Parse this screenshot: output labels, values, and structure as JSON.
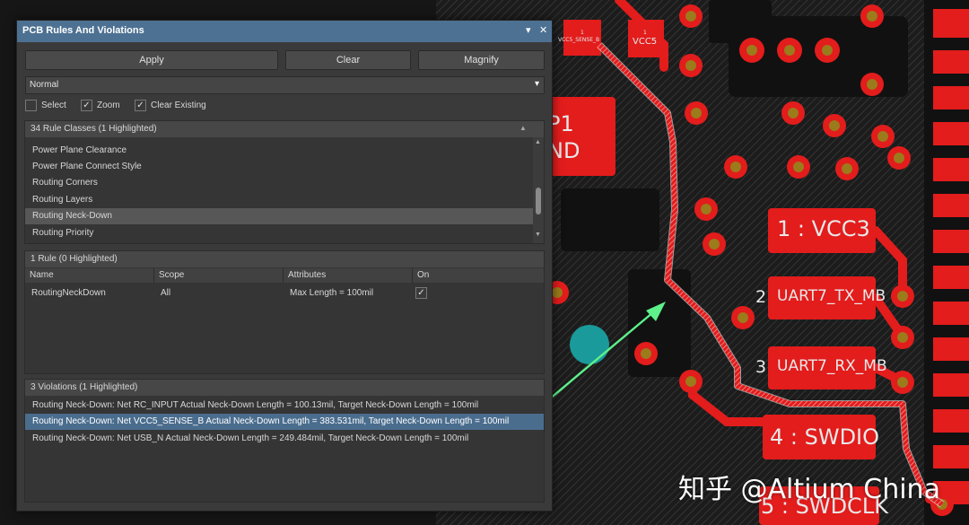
{
  "colors": {
    "panel_bg": "#3a3a3a",
    "titlebar": "#4d7192",
    "highlight": "#4a6d8e",
    "pcb_bg": "#1a1a1a",
    "copper_red": "#e31c1c",
    "pad_center": "#9b7b1b",
    "arrow_green": "#5ef08a",
    "teal_marker": "#1a9a9a"
  },
  "panel": {
    "title": "PCB Rules And Violations",
    "pin_icon": "▾",
    "close_icon": "✕",
    "buttons": {
      "apply": "Apply",
      "clear": "Clear",
      "magnify": "Magnify"
    },
    "mode": {
      "value": "Normal",
      "arrow": "▾"
    },
    "options": [
      {
        "label": "Select",
        "checked": false
      },
      {
        "label": "Zoom",
        "checked": true
      },
      {
        "label": "Clear Existing",
        "checked": true
      }
    ],
    "check_mark": "✓",
    "rule_classes": {
      "header": "34 Rule Classes (1 Highlighted)",
      "items": [
        "Power Plane Clearance",
        "Power Plane Connect Style",
        "Routing Corners",
        "Routing Layers",
        "Routing Neck-Down",
        "Routing Priority"
      ],
      "selected_index": 4
    },
    "rules": {
      "header": "1 Rule (0 Highlighted)",
      "columns": [
        "Name",
        "Scope",
        "Attributes",
        "On"
      ],
      "rows": [
        {
          "name": "RoutingNeckDown",
          "scope": "All",
          "attributes": "Max Length = 100mil",
          "on": true
        }
      ]
    },
    "violations": {
      "header": "3 Violations (1 Highlighted)",
      "items": [
        "Routing Neck-Down: Net RC_INPUT Actual Neck-Down Length = 100.13mil,  Target Neck-Down Length = 100mil",
        "Routing Neck-Down: Net VCC5_SENSE_B Actual Neck-Down Length = 383.531mil,  Target Neck-Down Length = 100mil",
        "Routing Neck-Down: Net USB_N Actual Neck-Down Length = 249.484mil,  Target Neck-Down Length = 100mil"
      ],
      "selected_index": 1
    }
  },
  "pcb": {
    "labels": {
      "vcc5_sense": "VCC5_SENSE_B",
      "vcc5": "VCC5",
      "pad1_top": "1",
      "pad1_top2": "1",
      "p1": "P1",
      "nd": "ND",
      "vcc3": "1 : VCC3",
      "uart_tx_num": "2",
      "uart_tx": "UART7_TX_MB",
      "uart_rx_num": "3",
      "uart_rx": "UART7_RX_MB",
      "swdio": "4 : SWDIO",
      "swdclk": "5 : SWDCLK"
    }
  },
  "watermark": "知乎 @Altium China"
}
